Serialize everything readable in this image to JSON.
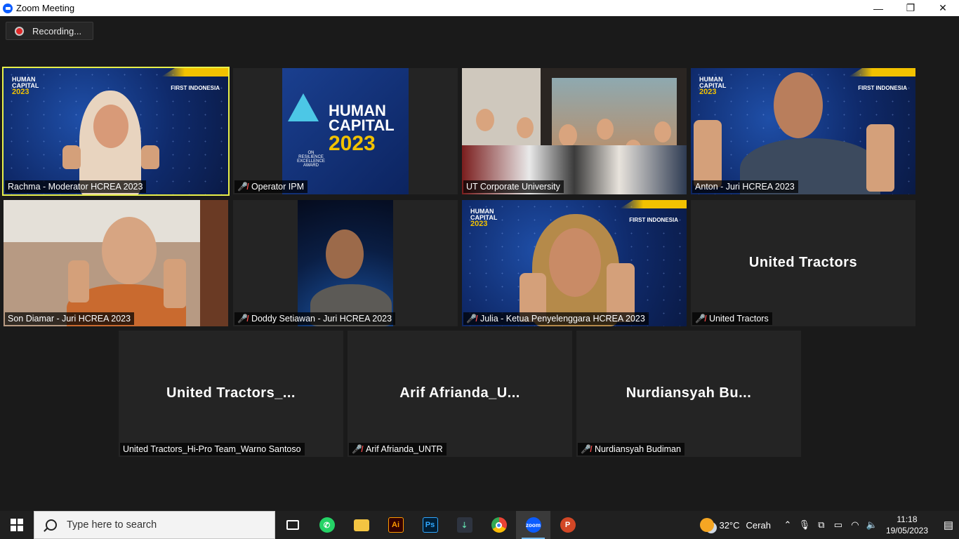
{
  "window": {
    "title": "Zoom Meeting",
    "minimize": "—",
    "restore": "❐",
    "close": "✕"
  },
  "recording": {
    "label": "Recording..."
  },
  "tiles": [
    {
      "name": "Rachma - Moderator HCREA 2023",
      "muted": false
    },
    {
      "name": "Operator IPM",
      "muted": true,
      "logo_line1": "HUMAN",
      "logo_line2": "CAPITAL",
      "logo_line3": "2023",
      "logo_sub": "ON RESILIENCE EXCELLENCE AWARD"
    },
    {
      "name": "UT Corporate University",
      "muted": false
    },
    {
      "name": "Anton - Juri HCREA 2023",
      "muted": false
    },
    {
      "name": "Son Diamar - Juri HCREA 2023",
      "muted": false
    },
    {
      "name": "Doddy Setiawan - Juri HCREA 2023",
      "muted": true
    },
    {
      "name": "Julia - Ketua Penyelenggara HCREA 2023",
      "muted": true
    },
    {
      "name": "United Tractors",
      "muted": true,
      "display": "United Tractors"
    },
    {
      "name": "United Tractors_Hi-Pro Team_Warno Santoso",
      "muted": false,
      "display": "United  Tractors_..."
    },
    {
      "name": "Arif Afrianda_UNTR",
      "muted": true,
      "display": "Arif  Afrianda_U..."
    },
    {
      "name": "Nurdiansyah Budiman",
      "muted": true,
      "display": "Nurdiansyah  Bu..."
    }
  ],
  "background": {
    "hc_line1": "HUMAN",
    "hc_line2": "CAPITAL",
    "hc_year": "2023",
    "first_indonesia": "FIRST INDONESIA"
  },
  "taskbar": {
    "search_placeholder": "Type here to search",
    "weather_temp": "32°C",
    "weather_text": "Cerah",
    "time": "11:18",
    "date": "19/05/2023"
  },
  "colors": {
    "active_speaker": "#e8f04a",
    "zoom_blue": "#0b5cff",
    "muted_red": "#ff4d4d",
    "taskbar": "#202020"
  }
}
